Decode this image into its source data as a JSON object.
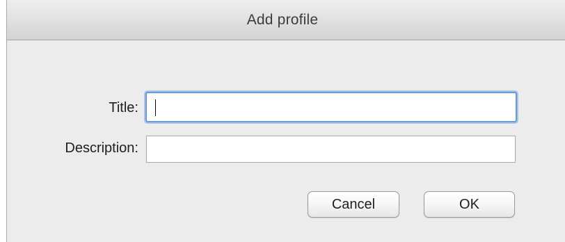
{
  "window": {
    "title": "Add profile"
  },
  "form": {
    "title_label": "Title:",
    "title_value": "",
    "description_label": "Description:",
    "description_value": ""
  },
  "buttons": {
    "cancel": "Cancel",
    "ok": "OK"
  }
}
